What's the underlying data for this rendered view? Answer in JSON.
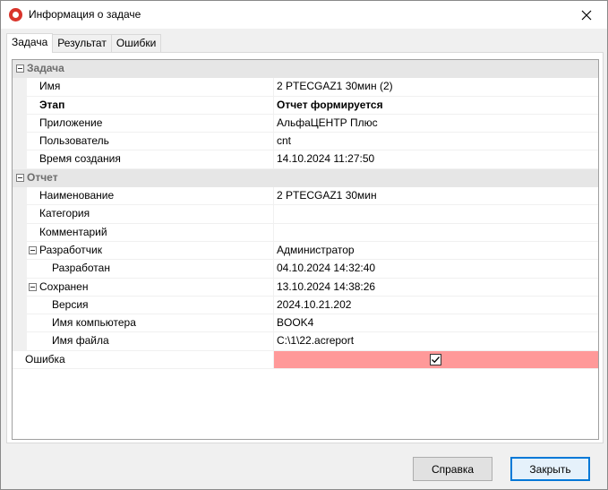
{
  "window": {
    "title": "Информация о задаче",
    "close_icon": "close-icon"
  },
  "tabs": [
    {
      "label": "Задача",
      "active": true
    },
    {
      "label": "Результат",
      "active": false
    },
    {
      "label": "Ошибки",
      "active": false
    }
  ],
  "grid": {
    "task_category": "Задача",
    "report_category": "Отчет",
    "rows": {
      "name": {
        "label": "Имя",
        "value": "2 PTECGAZ1 30мин (2)"
      },
      "stage": {
        "label": "Этап",
        "value": "Отчет формируется"
      },
      "application": {
        "label": "Приложение",
        "value": "АльфаЦЕНТР Плюс"
      },
      "user": {
        "label": "Пользователь",
        "value": "cnt"
      },
      "created": {
        "label": "Время создания",
        "value": "14.10.2024 11:27:50"
      },
      "title": {
        "label": "Наименование",
        "value": "2 PTECGAZ1 30мин"
      },
      "category": {
        "label": "Категория",
        "value": ""
      },
      "comment": {
        "label": "Комментарий",
        "value": ""
      },
      "developer": {
        "label": "Разработчик",
        "value": "Администратор"
      },
      "developed": {
        "label": "Разработан",
        "value": "04.10.2024 14:32:40"
      },
      "saved": {
        "label": "Сохранен",
        "value": "13.10.2024 14:38:26"
      },
      "version": {
        "label": "Версия",
        "value": "2024.10.21.202"
      },
      "computer": {
        "label": "Имя компьютера",
        "value": "BOOK4"
      },
      "file": {
        "label": "Имя файла",
        "value": "C:\\1\\22.acreport"
      },
      "error": {
        "label": "Ошибка",
        "checked": true
      }
    },
    "error_color": "#ff9999"
  },
  "buttons": {
    "help": "Справка",
    "close": "Закрыть"
  },
  "colors": {
    "accent": "#0078d7",
    "app_icon": "#d9342b"
  }
}
